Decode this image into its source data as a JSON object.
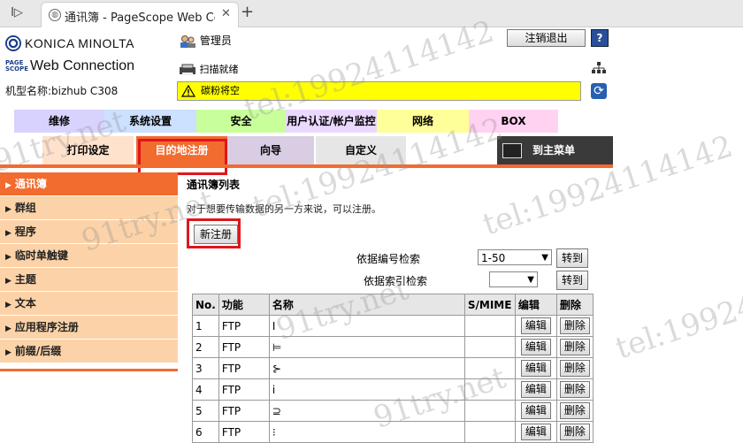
{
  "browser": {
    "tab_title": "通讯簿 - PageScope Web Con",
    "sidebar_toggle": "I▷",
    "close_tab": "✕",
    "new_tab": "+"
  },
  "header": {
    "brand_konica": "KONICA MINOLTA",
    "brand_ps_line1": "PAGE",
    "brand_ps_line2": "SCOPE",
    "brand_webconnection": "Web Connection",
    "model_label": "机型名称:bizhub C308",
    "user": "管理员",
    "status": "扫描就绪",
    "warning": "碳粉将空",
    "logout_label": "注销退出",
    "help_label": "?"
  },
  "main_tabs": [
    {
      "label": "维修",
      "color": "#d8d2ff"
    },
    {
      "label": "系统设置",
      "color": "#cce0ff"
    },
    {
      "label": "安全",
      "color": "#c8ff9a"
    },
    {
      "label": "用户认证/帐户监控",
      "color": "#ead8ff"
    },
    {
      "label": "网络",
      "color": "#ffff99"
    },
    {
      "label": "BOX",
      "color": "#ffd2f2"
    }
  ],
  "sub_tabs": [
    {
      "label": "打印设定"
    },
    {
      "label": "目的地注册"
    },
    {
      "label": "向导"
    },
    {
      "label": "自定义"
    }
  ],
  "to_main_menu": "到主菜单",
  "sidebar": {
    "items": [
      {
        "label": "通讯簿"
      },
      {
        "label": "群组"
      },
      {
        "label": "程序"
      },
      {
        "label": "临时单触键"
      },
      {
        "label": "主题"
      },
      {
        "label": "文本"
      },
      {
        "label": "应用程序注册"
      },
      {
        "label": "前缀/后缀"
      }
    ]
  },
  "content": {
    "title": "通讯簿列表",
    "description": "对于想要传输数据的另一方来说，可以注册。",
    "new_button": "新注册",
    "search_by_number": "依据编号检索",
    "search_by_number_value": "1-50",
    "search_by_index": "依据索引检索",
    "search_by_index_value": "",
    "go_label": "转到",
    "columns": [
      "No.",
      "功能",
      "名称",
      "S/MIME",
      "编辑",
      "删除"
    ],
    "rows": [
      {
        "no": "1",
        "func": "FTP",
        "name": "ⵏ"
      },
      {
        "no": "2",
        "func": "FTP",
        "name": "⊨"
      },
      {
        "no": "3",
        "func": "FTP",
        "name": "⊱"
      },
      {
        "no": "4",
        "func": "FTP",
        "name": "ⅰ"
      },
      {
        "no": "5",
        "func": "FTP",
        "name": "⊇"
      },
      {
        "no": "6",
        "func": "FTP",
        "name": "⁝"
      }
    ],
    "edit_label": "编辑",
    "delete_label": "删除"
  },
  "watermark": [
    "91try.net",
    "tel:19924114142"
  ]
}
